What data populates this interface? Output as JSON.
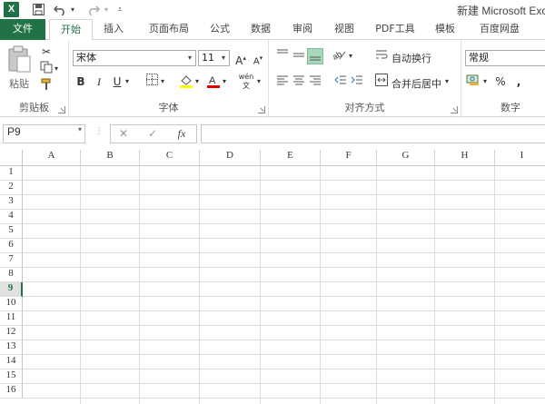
{
  "window": {
    "title": "新建 Microsoft Exce",
    "app_icon": "X"
  },
  "qat": {
    "save_icon": "save-icon",
    "undo_icon": "undo-icon",
    "redo_icon": "redo-icon"
  },
  "tabs": [
    "文件",
    "开始",
    "插入",
    "页面布局",
    "公式",
    "数据",
    "审阅",
    "视图",
    "PDF工具",
    "模板",
    "百度网盘"
  ],
  "ribbon": {
    "clipboard": {
      "label": "剪贴板",
      "paste": "粘贴"
    },
    "font": {
      "label": "字体",
      "name": "宋体",
      "size": "11",
      "bold": "B",
      "italic": "I",
      "underline": "U",
      "phonetic": "wén"
    },
    "alignment": {
      "label": "对齐方式",
      "wrap": "自动换行",
      "merge": "合并后居中"
    },
    "number": {
      "label": "数字",
      "format": "常规",
      "percent": "%",
      "comma": ","
    }
  },
  "formula_bar": {
    "name_box": "P9",
    "fx": "fx",
    "value": ""
  },
  "sheet": {
    "columns": [
      "A",
      "B",
      "C",
      "D",
      "E",
      "F",
      "G",
      "H",
      "I"
    ],
    "rows": [
      "1",
      "2",
      "3",
      "4",
      "5",
      "6",
      "7",
      "8",
      "9",
      "10",
      "11",
      "12",
      "13",
      "14",
      "15",
      "16"
    ],
    "selected_row": "9"
  }
}
